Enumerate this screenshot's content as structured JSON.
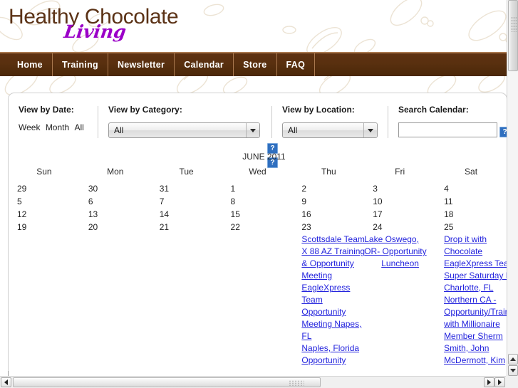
{
  "site": {
    "logo_main": "Healthy Chocolate",
    "logo_script": "Living"
  },
  "nav": {
    "items": [
      {
        "label": "Home",
        "name": "nav-item-home"
      },
      {
        "label": "Training",
        "name": "nav-item-training"
      },
      {
        "label": "Newsletter",
        "name": "nav-item-newsletter"
      },
      {
        "label": "Calendar",
        "name": "nav-item-calendar"
      },
      {
        "label": "Store",
        "name": "nav-item-store"
      },
      {
        "label": "FAQ",
        "name": "nav-item-faq"
      }
    ]
  },
  "filters": {
    "date": {
      "label": "View by Date:",
      "links": [
        "Week",
        "Month",
        "All"
      ],
      "links_text": "Week Month All"
    },
    "category": {
      "label": "View by Category:",
      "selected": "All",
      "options": [
        "All"
      ]
    },
    "location": {
      "label": "View by Location:",
      "selected": "All",
      "options": [
        "All"
      ]
    },
    "search": {
      "label": "Search Calendar:",
      "value": "",
      "placeholder": ""
    },
    "help_icon_name": "broken-image-icon"
  },
  "calendar": {
    "title": "JUNE 2011",
    "weekdays": [
      "Sun",
      "Mon",
      "Tue",
      "Wed",
      "Thu",
      "Fri",
      "Sat"
    ],
    "weeks": [
      [
        "29",
        "30",
        "31",
        "1",
        "2",
        "3",
        "4"
      ],
      [
        "5",
        "6",
        "7",
        "8",
        "9",
        "10",
        "11"
      ],
      [
        "12",
        "13",
        "14",
        "15",
        "16",
        "17",
        "18"
      ],
      [
        "19",
        "20",
        "21",
        "22",
        "23",
        "24",
        "25"
      ]
    ],
    "events": {
      "thu": [
        "Scottsdale Team",
        "X 88 AZ Training",
        "& Opportunity",
        "Meeting",
        "EagleXpress",
        "Team",
        "Opportunity",
        "Meeting Napes,",
        "FL",
        "Naples, Florida",
        "Opportunity"
      ],
      "fri": [
        "Lake Oswego,",
        "OR- Opportunity",
        "Luncheon"
      ],
      "sat": [
        "Drop it with",
        "Chocolate",
        "EagleXpress Tea",
        "Super Saturday F",
        "Charlotte, FL",
        "Northern CA -",
        "Opportunity/Train",
        "with Millionaire",
        "Member Sherm",
        "Smith, John",
        "McDermott, Kim"
      ]
    }
  },
  "scrollbars": {
    "vertical_name": "vertical-scrollbar",
    "horizontal_name": "horizontal-scrollbar"
  },
  "colors": {
    "brand_brown": "#5b3216",
    "brand_purple": "#9b00c8",
    "nav_bg": "#59300f",
    "nav_border": "#a9784f",
    "link_blue": "#2323dd"
  }
}
